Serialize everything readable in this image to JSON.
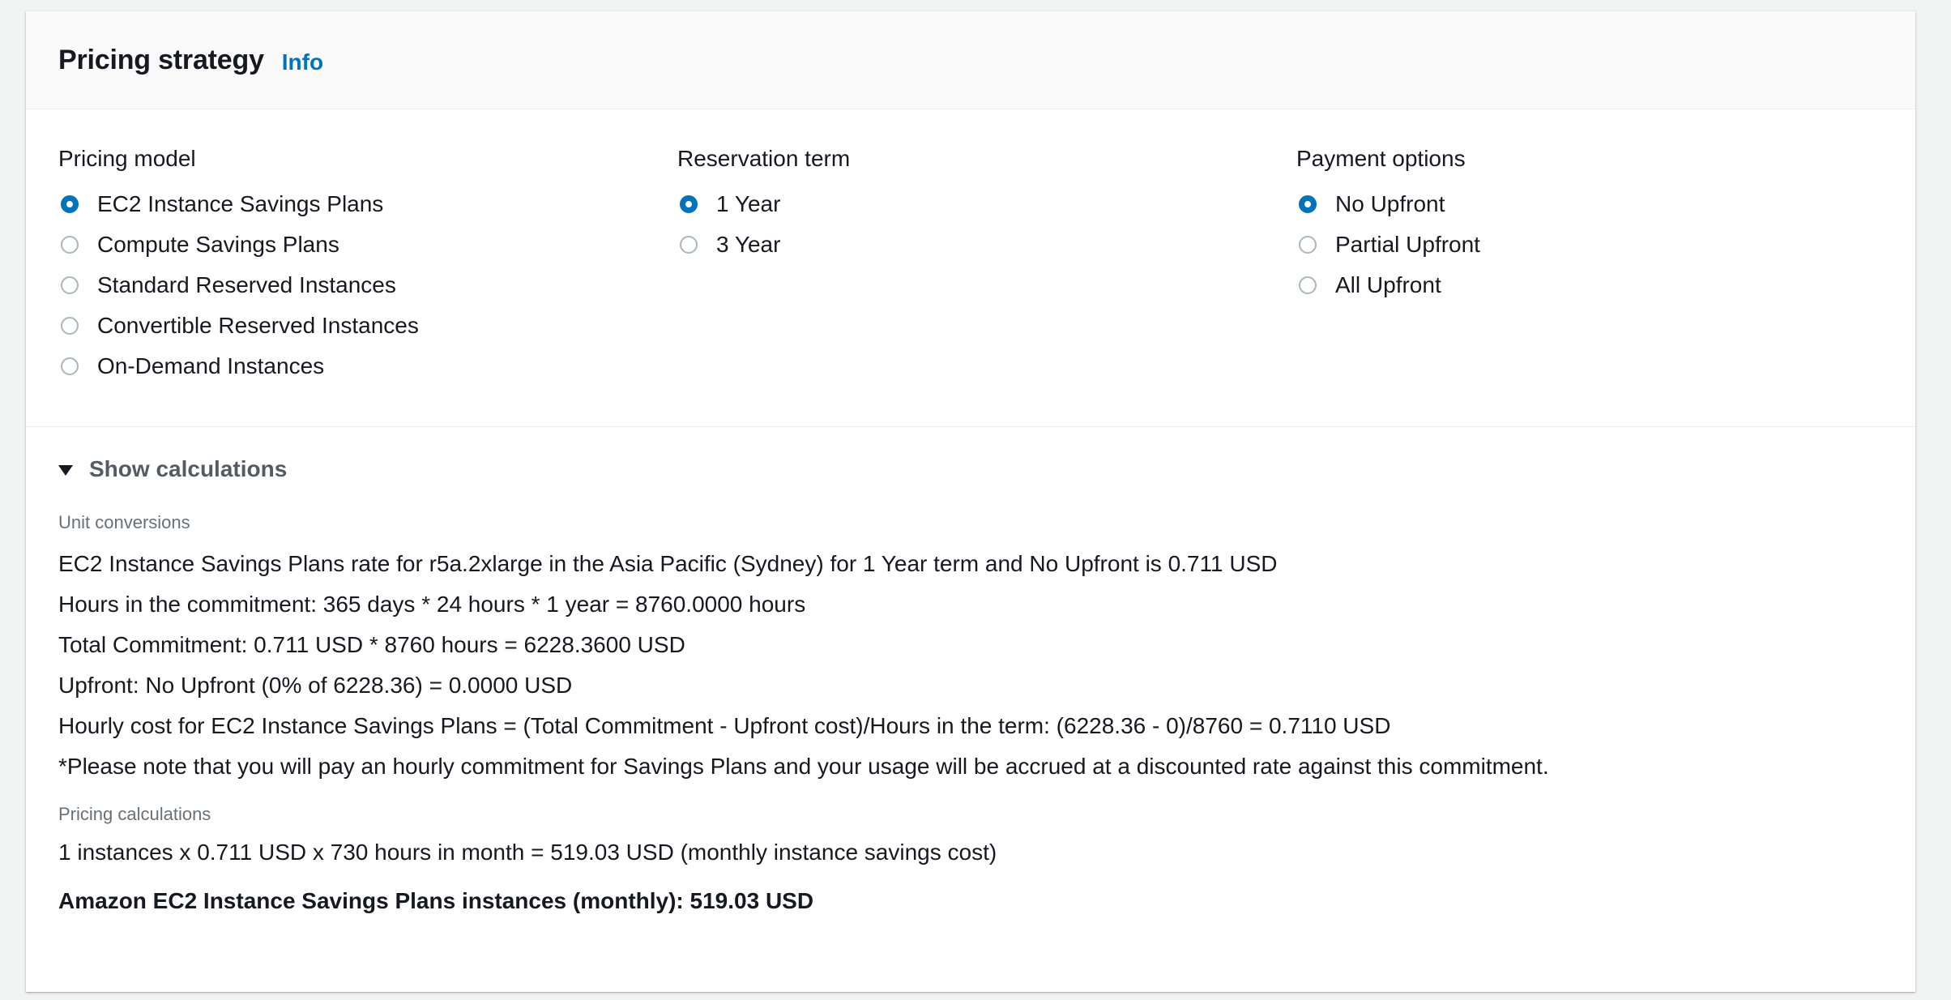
{
  "header": {
    "title": "Pricing strategy",
    "info_label": "Info"
  },
  "pricing_model": {
    "label": "Pricing model",
    "selected": "EC2 Instance Savings Plans",
    "options": [
      "EC2 Instance Savings Plans",
      "Compute Savings Plans",
      "Standard Reserved Instances",
      "Convertible Reserved Instances",
      "On-Demand Instances"
    ]
  },
  "reservation_term": {
    "label": "Reservation term",
    "selected": "1 Year",
    "options": [
      "1 Year",
      "3 Year"
    ]
  },
  "payment_options": {
    "label": "Payment options",
    "selected": "No Upfront",
    "options": [
      "No Upfront",
      "Partial Upfront",
      "All Upfront"
    ]
  },
  "calculations": {
    "toggle_label": "Show calculations",
    "expanded": true,
    "unit_conversions_label": "Unit conversions",
    "unit_conversions": [
      "EC2 Instance Savings Plans rate for r5a.2xlarge in the Asia Pacific (Sydney) for 1 Year term and No Upfront is 0.711 USD",
      "Hours in the commitment: 365 days * 24 hours * 1 year = 8760.0000 hours",
      "Total Commitment: 0.711 USD * 8760 hours = 6228.3600 USD",
      "Upfront: No Upfront (0% of 6228.36) = 0.0000 USD",
      "Hourly cost for EC2 Instance Savings Plans = (Total Commitment - Upfront cost)/Hours in the term: (6228.36 - 0)/8760 = 0.7110 USD",
      "*Please note that you will pay an hourly commitment for Savings Plans and your usage will be accrued at a discounted rate against this commitment."
    ],
    "pricing_calculations_label": "Pricing calculations",
    "pricing_calculation": "1 instances x 0.711 USD x 730 hours in month = 519.03 USD (monthly instance savings cost)",
    "total": "Amazon EC2 Instance Savings Plans instances (monthly): 519.03 USD"
  },
  "colors": {
    "accent": "#0073bb",
    "radio_border": "#aab7b8",
    "text": "#16191f",
    "muted": "#687078"
  }
}
